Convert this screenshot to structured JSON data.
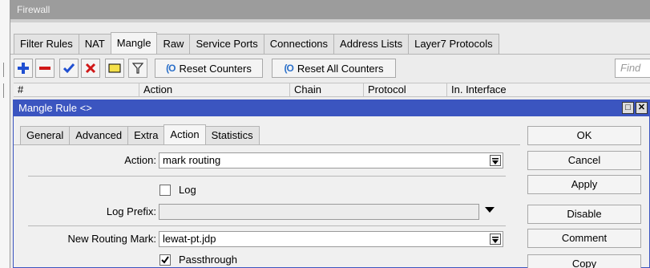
{
  "window": {
    "title": "Firewall"
  },
  "tabs": [
    "Filter Rules",
    "NAT",
    "Mangle",
    "Raw",
    "Service Ports",
    "Connections",
    "Address Lists",
    "Layer7 Protocols"
  ],
  "active_tab": "Mangle",
  "toolbar": {
    "reset_counters": "Reset Counters",
    "reset_all_counters": "Reset All Counters",
    "find_placeholder": "Find"
  },
  "table": {
    "columns": [
      "#",
      "Action",
      "Chain",
      "Protocol",
      "In. Interface"
    ]
  },
  "dialog": {
    "title": "Mangle Rule <>",
    "tabs": [
      "General",
      "Advanced",
      "Extra",
      "Action",
      "Statistics"
    ],
    "active_tab": "Action",
    "fields": {
      "action": {
        "label": "Action:",
        "value": "mark routing"
      },
      "log": {
        "label": "Log",
        "checked": false
      },
      "log_prefix": {
        "label": "Log Prefix:",
        "value": ""
      },
      "new_routing_mark": {
        "label": "New Routing Mark:",
        "value": "lewat-pt.jdp"
      },
      "passthrough": {
        "label": "Passthrough",
        "checked": true
      }
    },
    "buttons": [
      "OK",
      "Cancel",
      "Apply",
      "Disable",
      "Comment",
      "Copy"
    ]
  },
  "colors": {
    "dialog_title_bar": "#3b55c0",
    "window_title_bar": "#9c9c9c",
    "add_icon": "#1f4fd1",
    "remove_icon": "#d01818",
    "enable_icon": "#1f4fd1",
    "disable_icon": "#d01818"
  }
}
